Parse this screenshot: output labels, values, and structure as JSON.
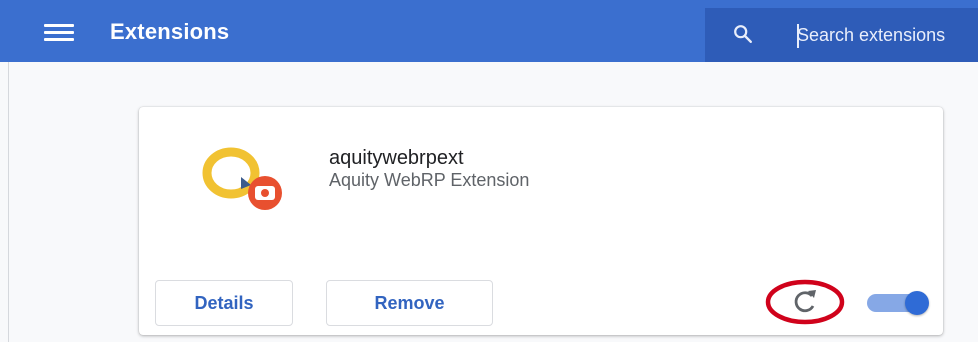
{
  "header": {
    "title": "Extensions",
    "menu_icon": "hamburger-menu-icon",
    "background_color": "#3b6fcf"
  },
  "search": {
    "icon": "search-icon",
    "placeholder": "Search extensions",
    "value": ""
  },
  "extension": {
    "name": "aquitywebrpext",
    "description": "Aquity WebRP Extension",
    "icon": "aquity-webrp-logo-icon",
    "details_label": "Details",
    "remove_label": "Remove",
    "reload_icon": "reload-icon",
    "reload_highlight_color": "#d0021b",
    "enabled": true,
    "accent_color": "#3264c0"
  }
}
